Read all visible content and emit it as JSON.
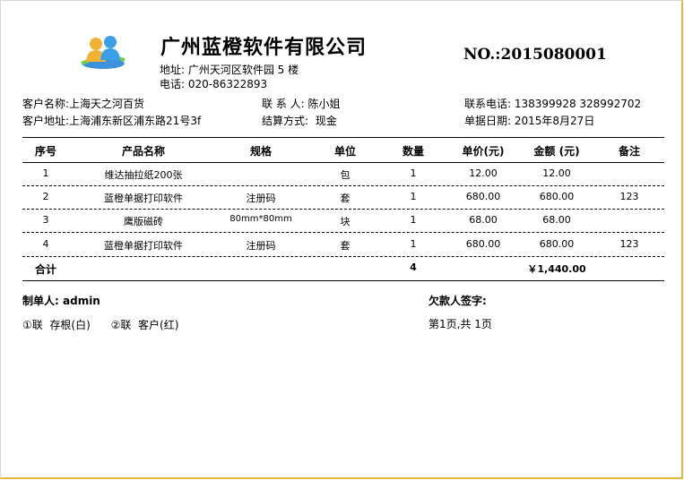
{
  "header": {
    "company_name": "广州蓝橙软件有限公司",
    "address": "地址: 广州天河区软件园 5 楼",
    "phone": "电话: 020-86322893",
    "doc_no": "NO.:2015080001"
  },
  "customer": {
    "name_label": "客户名称:",
    "name": "上海天之河百货",
    "address_label": "客户地址:",
    "address": "上海浦东新区浦东路21号3f",
    "contact_label": "联 系 人:",
    "contact": "陈小姐",
    "settlement_label": "结算方式:",
    "settlement": "现金",
    "phone_label": "联系电话:",
    "phone": "138399928 328992702",
    "date_label": "单据日期:",
    "date": "2015年8月27日"
  },
  "table": {
    "columns": [
      "序号",
      "产品名称",
      "规格",
      "单位",
      "数量",
      "单价(元)",
      "金额 (元)",
      "备注"
    ],
    "rows": [
      [
        "1",
        "维达抽拉纸200张",
        "",
        "包",
        "1",
        "12.00",
        "12.00",
        ""
      ],
      [
        "2",
        "蓝橙单据打印软件",
        "注册码",
        "套",
        "1",
        "680.00",
        "680.00",
        "123"
      ],
      [
        "3",
        "鹰版磁砖",
        "80mm*80mm",
        "块",
        "1",
        "68.00",
        "68.00",
        ""
      ],
      [
        "4",
        "蓝橙单据打印软件",
        "注册码",
        "套",
        "1",
        "680.00",
        "680.00",
        "123"
      ]
    ],
    "total_label": "合计",
    "total_qty": "4",
    "total_amount": "￥1,440.00"
  },
  "footer": {
    "maker_label": "制单人:",
    "maker": "admin",
    "copies": "①联  存根(白)      ②联  客户(红)",
    "signature_label": "欠款人签字:",
    "page_info": "第1页,共 1页"
  }
}
